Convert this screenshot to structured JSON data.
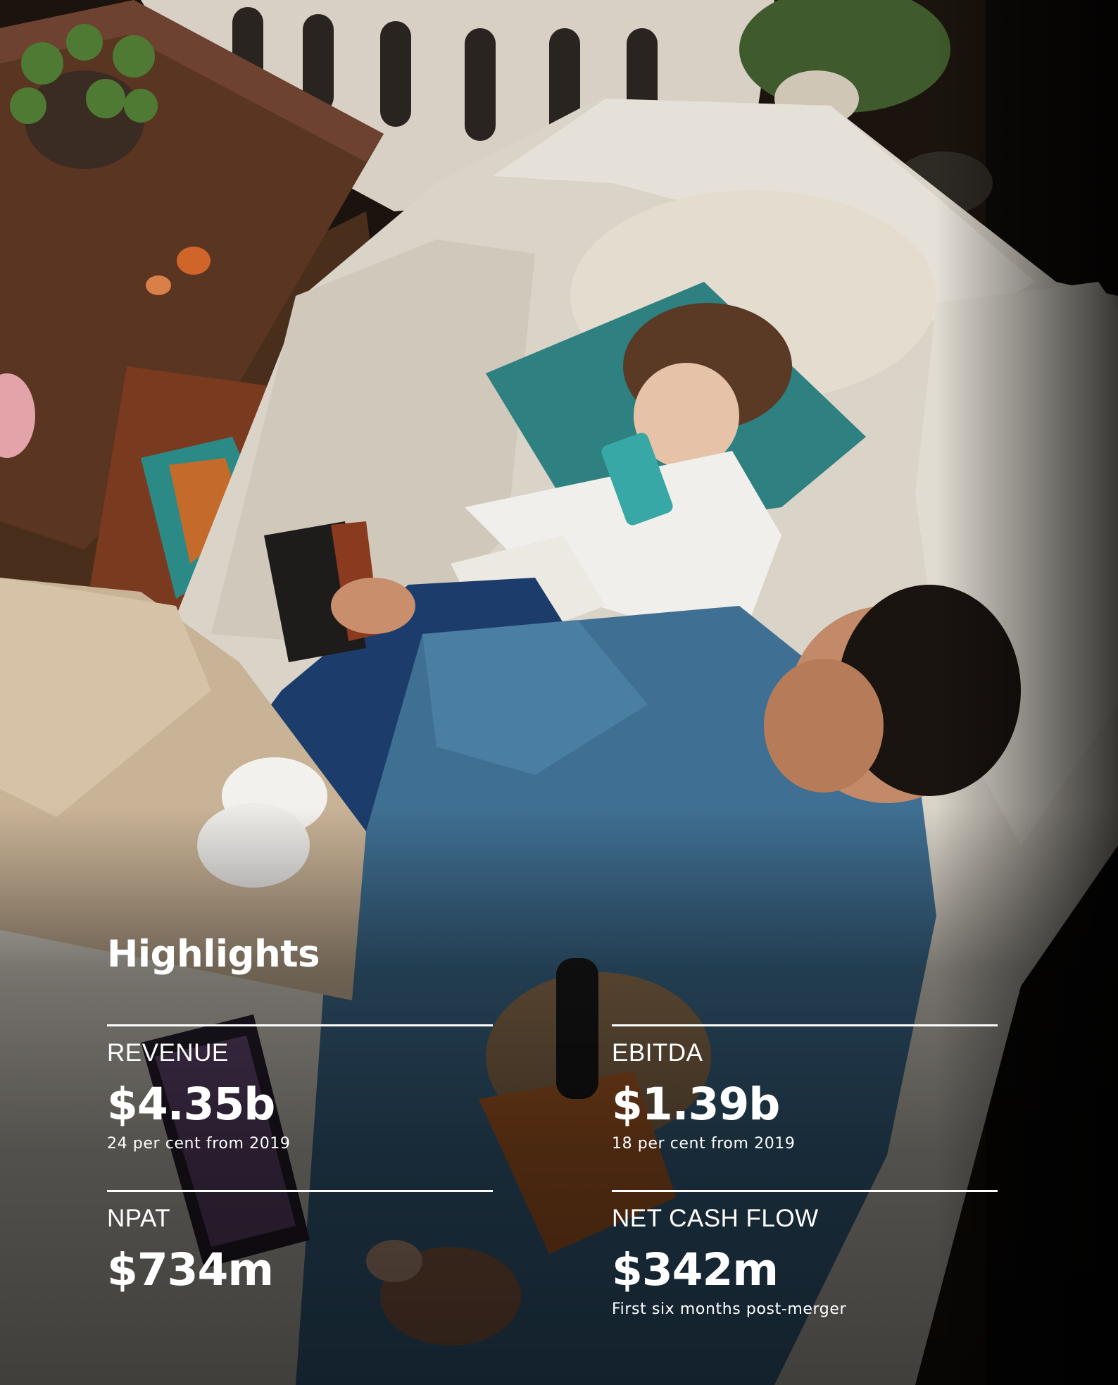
{
  "title": "Highlights",
  "metrics": [
    {
      "label": "REVENUE",
      "value": "$4.35b",
      "note": "24 per cent from 2019"
    },
    {
      "label": "EBITDA",
      "value": "$1.39b",
      "note": "18 per cent from 2019"
    },
    {
      "label": "NPAT",
      "value": "$734m",
      "note": ""
    },
    {
      "label": "NET CASH FLOW",
      "value": "$342m",
      "note": "First six months post-merger"
    }
  ],
  "colors": {
    "text": "#ffffff",
    "rule": "#ffffff",
    "background": "#0b0906"
  },
  "photo": {
    "subject": "family-on-sofa-with-devices"
  }
}
